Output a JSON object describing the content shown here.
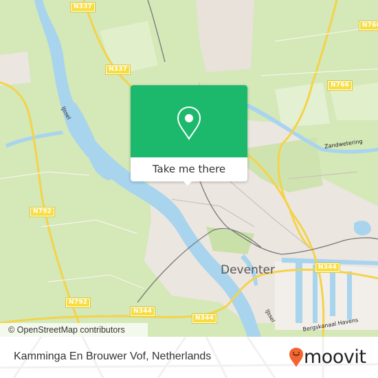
{
  "map": {
    "place_label": "Deventer",
    "road_labels": [
      "N337",
      "N337",
      "N766",
      "N766",
      "N792",
      "N792",
      "N344",
      "N344",
      "N344"
    ],
    "water_labels": [
      "IJssel",
      "IJssel",
      "Zandwetering",
      "Bergskanaal Havens"
    ],
    "attribution": "© OpenStreetMap contributors",
    "colors": {
      "land": "#d4e8b8",
      "urban": "#ece6e1",
      "water": "#a8d4ee",
      "road_major": "#f8d74a",
      "rail": "#777777"
    }
  },
  "popup": {
    "icon": "map-pin-icon",
    "cta_label": "Take me there",
    "accent_color": "#1cb86b"
  },
  "footer": {
    "title": "Kamminga En Brouwer Vof, Netherlands",
    "logo_text": "moovit",
    "logo_icon": "moovit-smiley-pin-icon",
    "logo_color": "#f26530"
  }
}
